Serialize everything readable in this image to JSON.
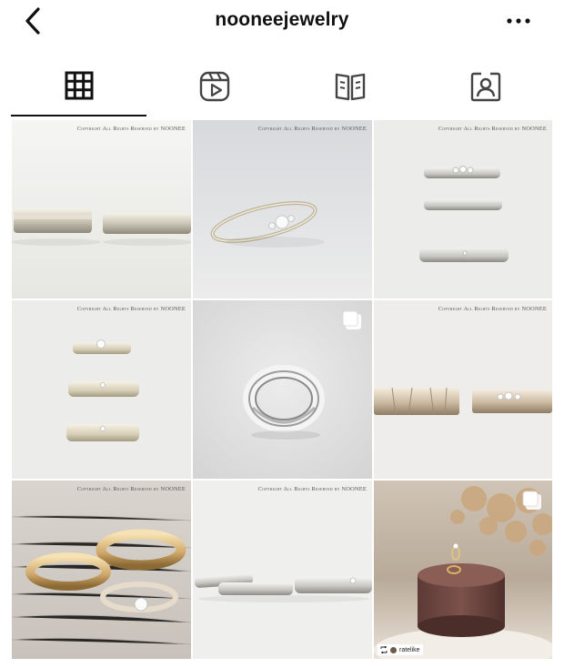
{
  "header": {
    "username": "nooneejewelry"
  },
  "tabs": [
    {
      "icon": "grid-icon",
      "active": true
    },
    {
      "icon": "reels-icon",
      "active": false
    },
    {
      "icon": "guide-icon",
      "active": false
    },
    {
      "icon": "tagged-icon",
      "active": false
    }
  ],
  "posts": [
    {
      "copyright": "Copyright All Rights Reserved by NOONEE"
    },
    {
      "copyright": "Copyright All Rights Reserved by NOONEE"
    },
    {
      "copyright": "Copyright All Rights Reserved by NOONEE"
    },
    {
      "copyright": "Copyright All Rights Reserved by NOONEE"
    },
    {
      "copyright": ""
    },
    {
      "copyright": "Copyright All Rights Reserved by NOONEE"
    },
    {
      "copyright": "Copyright All Rights Reserved by NOONEE"
    },
    {
      "copyright": "Copyright All Rights Reserved by NOONEE"
    },
    {
      "copyright": "",
      "repost_user": "ratelike"
    }
  ]
}
